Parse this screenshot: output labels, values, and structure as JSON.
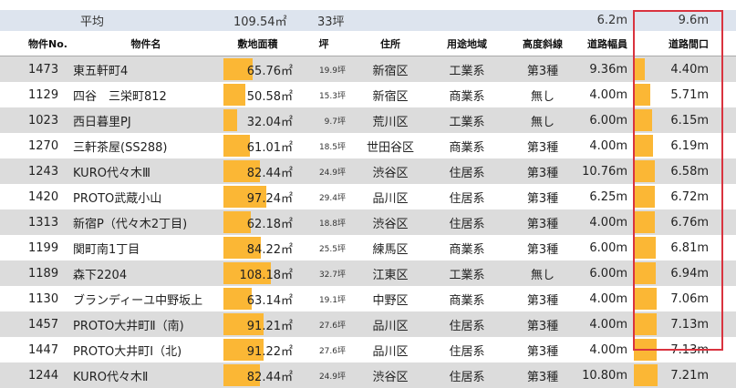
{
  "summary": {
    "label": "平均",
    "area": "109.54㎡",
    "tsubo": "33坪",
    "road_width": "6.2m",
    "road_frontage": "9.6m"
  },
  "columns": {
    "id": "物件No.",
    "name": "物件名",
    "area": "敷地面積",
    "tsubo": "坪",
    "address": "住所",
    "zone": "用途地域",
    "height": "高度斜線",
    "road_width": "道路幅員",
    "road_frontage": "道路間口"
  },
  "rows": [
    {
      "id": "1473",
      "name": "東五軒町4",
      "area": "65.76㎡",
      "area_value": 65.76,
      "tsubo": "19.9坪",
      "address": "新宿区",
      "zone": "工業系",
      "height": "第3種",
      "road_width": "9.36m",
      "road_frontage": "4.40m",
      "frontage_value": 4.4
    },
    {
      "id": "1129",
      "name": "四谷　三栄町812",
      "area": "50.58㎡",
      "area_value": 50.58,
      "tsubo": "15.3坪",
      "address": "新宿区",
      "zone": "商業系",
      "height": "無し",
      "road_width": "4.00m",
      "road_frontage": "5.71m",
      "frontage_value": 5.71
    },
    {
      "id": "1023",
      "name": "西日暮里PJ",
      "area": "32.04㎡",
      "area_value": 32.04,
      "tsubo": "9.7坪",
      "address": "荒川区",
      "zone": "工業系",
      "height": "無し",
      "road_width": "6.00m",
      "road_frontage": "6.15m",
      "frontage_value": 6.15
    },
    {
      "id": "1270",
      "name": "三軒茶屋(SS288)",
      "area": "61.01㎡",
      "area_value": 61.01,
      "tsubo": "18.5坪",
      "address": "世田谷区",
      "zone": "商業系",
      "height": "第3種",
      "road_width": "4.00m",
      "road_frontage": "6.19m",
      "frontage_value": 6.19
    },
    {
      "id": "1243",
      "name": "KURO代々木Ⅲ",
      "area": "82.44㎡",
      "area_value": 82.44,
      "tsubo": "24.9坪",
      "address": "渋谷区",
      "zone": "住居系",
      "height": "第3種",
      "road_width": "10.76m",
      "road_frontage": "6.58m",
      "frontage_value": 6.58
    },
    {
      "id": "1420",
      "name": "PROTO武蔵小山",
      "area": "97.24㎡",
      "area_value": 97.24,
      "tsubo": "29.4坪",
      "address": "品川区",
      "zone": "住居系",
      "height": "第3種",
      "road_width": "6.25m",
      "road_frontage": "6.72m",
      "frontage_value": 6.72
    },
    {
      "id": "1313",
      "name": "新宿P（代々木2丁目)",
      "area": "62.18㎡",
      "area_value": 62.18,
      "tsubo": "18.8坪",
      "address": "渋谷区",
      "zone": "住居系",
      "height": "第3種",
      "road_width": "4.00m",
      "road_frontage": "6.76m",
      "frontage_value": 6.76
    },
    {
      "id": "1199",
      "name": "関町南1丁目",
      "area": "84.22㎡",
      "area_value": 84.22,
      "tsubo": "25.5坪",
      "address": "練馬区",
      "zone": "商業系",
      "height": "第3種",
      "road_width": "6.00m",
      "road_frontage": "6.81m",
      "frontage_value": 6.81
    },
    {
      "id": "1189",
      "name": "森下2204",
      "area": "108.18㎡",
      "area_value": 108.18,
      "tsubo": "32.7坪",
      "address": "江東区",
      "zone": "工業系",
      "height": "無し",
      "road_width": "6.00m",
      "road_frontage": "6.94m",
      "frontage_value": 6.94
    },
    {
      "id": "1130",
      "name": "ブランディーユ中野坂上",
      "area": "63.14㎡",
      "area_value": 63.14,
      "tsubo": "19.1坪",
      "address": "中野区",
      "zone": "商業系",
      "height": "第3種",
      "road_width": "4.00m",
      "road_frontage": "7.06m",
      "frontage_value": 7.06
    },
    {
      "id": "1457",
      "name": "PROTO大井町Ⅱ（南)",
      "area": "91.21㎡",
      "area_value": 91.21,
      "tsubo": "27.6坪",
      "address": "品川区",
      "zone": "住居系",
      "height": "第3種",
      "road_width": "4.00m",
      "road_frontage": "7.13m",
      "frontage_value": 7.13
    },
    {
      "id": "1447",
      "name": "PROTO大井町Ⅰ（北)",
      "area": "91.22㎡",
      "area_value": 91.22,
      "tsubo": "27.6坪",
      "address": "品川区",
      "zone": "住居系",
      "height": "第3種",
      "road_width": "4.00m",
      "road_frontage": "7.13m",
      "frontage_value": 7.13
    },
    {
      "id": "1244",
      "name": "KURO代々木Ⅱ",
      "area": "82.44㎡",
      "area_value": 82.44,
      "tsubo": "24.9坪",
      "address": "渋谷区",
      "zone": "住居系",
      "height": "第3種",
      "road_width": "10.80m",
      "road_frontage": "7.21m",
      "frontage_value": 7.21
    }
  ],
  "colors": {
    "bar": "#fbb735",
    "highlight_frame": "#d9333f",
    "stripe": "#dcdcdc",
    "summary_bg": "#dde4ee"
  }
}
